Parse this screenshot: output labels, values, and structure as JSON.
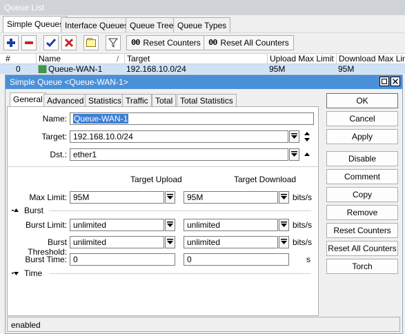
{
  "window": {
    "title": "Queue List"
  },
  "tabs": [
    {
      "label": "Simple Queues"
    },
    {
      "label": "Interface Queues"
    },
    {
      "label": "Queue Tree"
    },
    {
      "label": "Queue Types"
    }
  ],
  "toolbar": {
    "reset_counters": "Reset Counters",
    "reset_all_counters": "Reset All Counters",
    "oo": "00"
  },
  "table": {
    "columns": [
      "#",
      "Name",
      "Target",
      "Upload Max Limit",
      "Download Max Limit"
    ],
    "sort_mark": "/",
    "rows": [
      {
        "num": "0",
        "name": "Queue-WAN-1",
        "target": "192.168.10.0/24",
        "upload": "95M",
        "download": "95M"
      }
    ]
  },
  "dialog": {
    "title": "Simple Queue <Queue-WAN-1>",
    "tabs": [
      "General",
      "Advanced",
      "Statistics",
      "Traffic",
      "Total",
      "Total Statistics"
    ],
    "fields": {
      "name_label": "Name:",
      "name_value": "Queue-WAN-1",
      "target_label": "Target:",
      "target_value": "192.168.10.0/24",
      "dst_label": "Dst.:",
      "dst_value": "ether1"
    },
    "headers": {
      "upload": "Target Upload",
      "download": "Target Download"
    },
    "max_limit": {
      "label": "Max Limit:",
      "upload": "95M",
      "download": "95M",
      "unit": "bits/s"
    },
    "burst_section": "Burst",
    "burst_limit": {
      "label": "Burst Limit:",
      "upload": "unlimited",
      "download": "unlimited",
      "unit": "bits/s"
    },
    "burst_threshold": {
      "label": "Burst Threshold:",
      "upload": "unlimited",
      "download": "unlimited",
      "unit": "bits/s"
    },
    "burst_time": {
      "label": "Burst Time:",
      "upload": "0",
      "download": "0",
      "unit": "s"
    },
    "time_section": "Time",
    "buttons": [
      "OK",
      "Cancel",
      "Apply",
      "Disable",
      "Comment",
      "Copy",
      "Remove",
      "Reset Counters",
      "Reset All Counters",
      "Torch"
    ],
    "status": "enabled"
  },
  "colors": {
    "dialog_title_bg": "#4a90d9",
    "row_selected_bg": "#cfe2f7",
    "add_icon": "#1a3ea8",
    "remove_icon": "#cc2222",
    "enable_icon": "#1a3ea8",
    "disable_icon": "#cc2222"
  }
}
